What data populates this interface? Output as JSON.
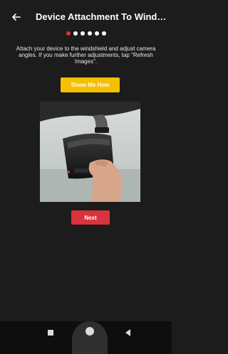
{
  "header": {
    "title": "Device Attachment To Windshi...",
    "back_icon": "arrow-left-icon"
  },
  "progress": {
    "total_steps": 6,
    "current_step": 1,
    "active_color": "#e0313b",
    "inactive_color": "#ffffff"
  },
  "instructions": "Attach your device to the windshield and adjust camera angles. If you make further adjustments, tap \"Refresh Images\".",
  "show_me_how": {
    "label": "Show Me How",
    "color": "#f5c000"
  },
  "photo": {
    "icon": "dashcam-mounted-photo"
  },
  "next_button": {
    "label": "Next",
    "color": "#d9333d"
  },
  "navbar": {
    "recent_icon": "recent-apps-icon",
    "home_icon": "home-icon",
    "back_icon": "nav-back-icon"
  }
}
